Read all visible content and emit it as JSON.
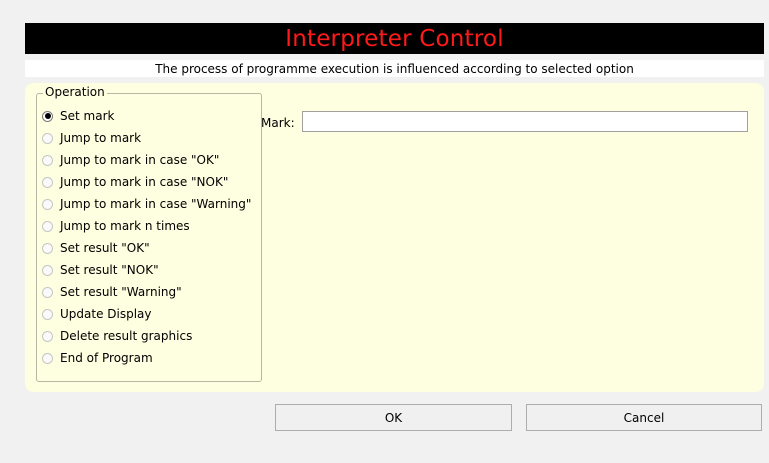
{
  "dialog": {
    "title": "Interpreter Control",
    "subtitle": "The process of programme execution is influenced according to selected option"
  },
  "operation": {
    "legend": "Operation",
    "options": [
      {
        "label": "Set mark",
        "checked": true
      },
      {
        "label": "Jump to mark",
        "checked": false
      },
      {
        "label": "Jump to mark in case \"OK\"",
        "checked": false
      },
      {
        "label": "Jump to mark in case \"NOK\"",
        "checked": false
      },
      {
        "label": "Jump to mark in case \"Warning\"",
        "checked": false
      },
      {
        "label": "Jump to mark n times",
        "checked": false
      },
      {
        "label": "Set result \"OK\"",
        "checked": false
      },
      {
        "label": "Set result \"NOK\"",
        "checked": false
      },
      {
        "label": "Set result \"Warning\"",
        "checked": false
      },
      {
        "label": "Update Display",
        "checked": false
      },
      {
        "label": "Delete result graphics",
        "checked": false
      },
      {
        "label": "End of Program",
        "checked": false
      }
    ]
  },
  "mark": {
    "label": "Mark:",
    "value": ""
  },
  "buttons": {
    "ok": "OK",
    "cancel": "Cancel"
  },
  "colors": {
    "title_background": "#000000",
    "title_text": "#ff1a1a",
    "panel_background": "#fefee0",
    "window_background": "#f1f1f1"
  }
}
